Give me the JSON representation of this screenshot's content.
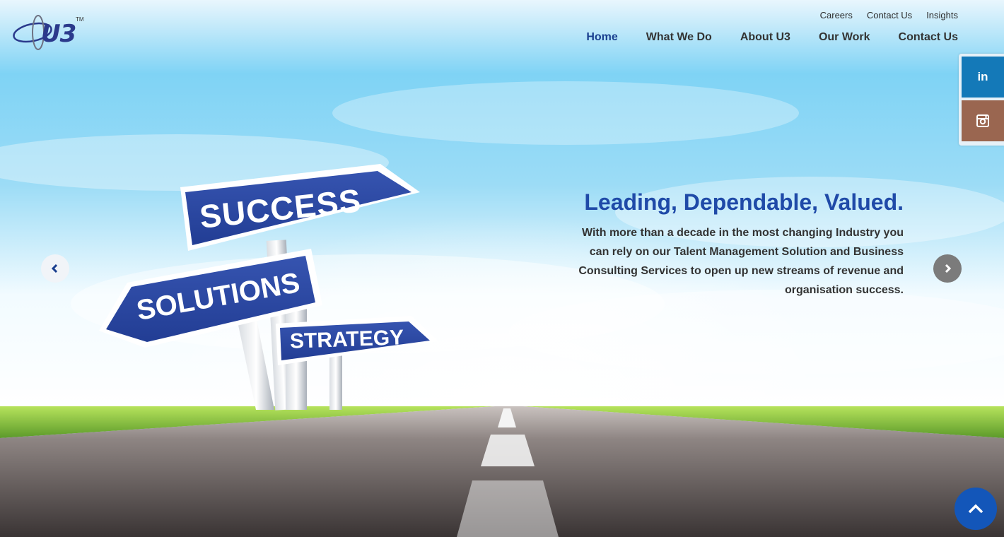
{
  "brand": {
    "logo_text": "U3",
    "trademark": "TM"
  },
  "top_nav": [
    "Careers",
    "Contact Us",
    "Insights"
  ],
  "main_nav": [
    {
      "label": "Home",
      "active": true
    },
    {
      "label": "What We Do",
      "active": false
    },
    {
      "label": "About U3",
      "active": false
    },
    {
      "label": "Our Work",
      "active": false
    },
    {
      "label": "Contact Us",
      "active": false
    }
  ],
  "social": {
    "linkedin_label": "in",
    "linkedin_icon": "linkedin-icon",
    "instagram_icon": "instagram-icon"
  },
  "hero": {
    "title": "Leading, Dependable, Valued.",
    "body": "With more than a decade in the most changing Industry you can rely on our Talent Management Solution and Business Consulting Services to open up new streams of revenue and organisation success.",
    "signs": [
      "SUCCESS",
      "SOLUTIONS",
      "STRATEGY"
    ]
  },
  "colors": {
    "accent": "#1f4aa8",
    "nav_active": "#1a3f8f",
    "linkedin": "#1479b8",
    "instagram": "#9a6650",
    "back_to_top": "#1356b9"
  }
}
